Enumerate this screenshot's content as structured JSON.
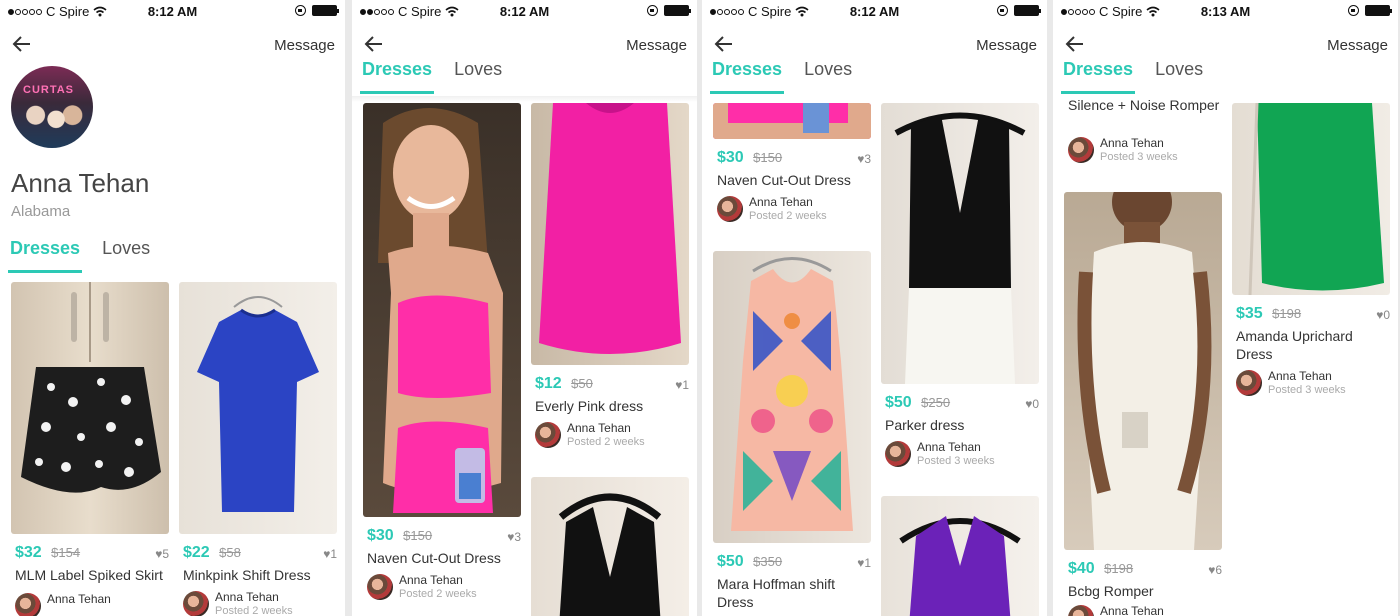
{
  "colors": {
    "accent": "#2cc9b5",
    "text": "#333333",
    "muted": "#999999"
  },
  "icons": {
    "back": "arrow-left-icon",
    "heart": "heart-icon"
  },
  "phones": [
    {
      "status": {
        "carrier": "C Spire",
        "time": "8:12 AM"
      },
      "nav": {
        "message": "Message"
      },
      "profile": {
        "name": "Anna Tehan",
        "location": "Alabama",
        "avatar_sign": "CURTAS"
      },
      "tabs": [
        "Dresses",
        "Loves"
      ],
      "items": [
        {
          "price": "$32",
          "orig": "$154",
          "likes": "♥5",
          "name": "MLM Label Spiked Skirt",
          "seller": "Anna Tehan",
          "posted": ""
        },
        {
          "price": "$22",
          "orig": "$58",
          "likes": "♥1",
          "name": "Minkpink Shift Dress",
          "seller": "Anna Tehan",
          "posted": "Posted 2 weeks"
        }
      ]
    },
    {
      "status": {
        "carrier": "C Spire",
        "time": "8:12 AM"
      },
      "nav": {
        "message": "Message"
      },
      "tabs": [
        "Dresses",
        "Loves"
      ],
      "items": [
        {
          "price": "$30",
          "orig": "$150",
          "likes": "♥3",
          "name": "Naven Cut-Out Dress",
          "seller": "Anna Tehan",
          "posted": "Posted 2 weeks"
        },
        {
          "price": "$12",
          "orig": "$50",
          "likes": "♥1",
          "name": "Everly Pink dress",
          "seller": "Anna Tehan",
          "posted": "Posted 2 weeks"
        }
      ]
    },
    {
      "status": {
        "carrier": "C Spire",
        "time": "8:12 AM"
      },
      "nav": {
        "message": "Message"
      },
      "tabs": [
        "Dresses",
        "Loves"
      ],
      "items": [
        {
          "price": "$30",
          "orig": "$150",
          "likes": "♥3",
          "name": "Naven Cut-Out Dress",
          "seller": "Anna Tehan",
          "posted": "Posted 2 weeks"
        },
        {
          "price": "$50",
          "orig": "$350",
          "likes": "♥1",
          "name": "Mara Hoffman shift Dress",
          "seller": "",
          "posted": ""
        },
        {
          "price": "$50",
          "orig": "$250",
          "likes": "♥0",
          "name": "Parker dress",
          "seller": "Anna Tehan",
          "posted": "Posted 3 weeks"
        }
      ]
    },
    {
      "status": {
        "carrier": "C Spire",
        "time": "8:13 AM"
      },
      "nav": {
        "message": "Message"
      },
      "tabs": [
        "Dresses",
        "Loves"
      ],
      "items": [
        {
          "price": "",
          "orig": "",
          "likes": "",
          "name": "Silence + Noise Romper",
          "seller": "Anna Tehan",
          "posted": "Posted 3 weeks"
        },
        {
          "price": "$40",
          "orig": "$198",
          "likes": "♥6",
          "name": "Bcbg Romper",
          "seller": "Anna Tehan",
          "posted": ""
        },
        {
          "price": "$35",
          "orig": "$198",
          "likes": "♥0",
          "name": "Amanda Uprichard Dress",
          "seller": "Anna Tehan",
          "posted": "Posted 3 weeks"
        }
      ]
    }
  ]
}
